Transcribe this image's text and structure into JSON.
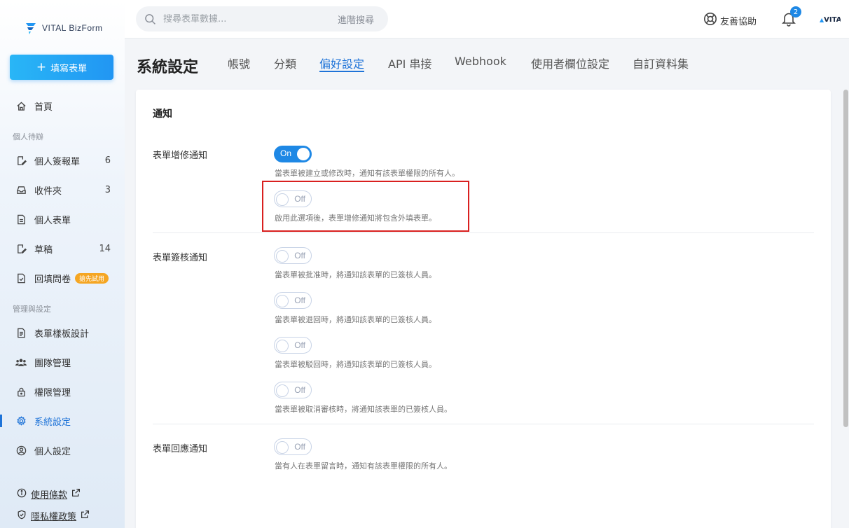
{
  "app": {
    "logo_text": "VITAL BizForm"
  },
  "sidebar": {
    "fill_form_label": "填寫表單",
    "home": "首頁",
    "personal_section": "個人待辦",
    "items_personal": [
      {
        "label": "個人簽報單",
        "count": "6"
      },
      {
        "label": "收件夾",
        "count": "3"
      },
      {
        "label": "個人表單",
        "count": ""
      },
      {
        "label": "草稿",
        "count": "14"
      },
      {
        "label": "回填問卷",
        "badge": "搶先試用"
      }
    ],
    "admin_section": "管理與設定",
    "items_admin": [
      {
        "label": "表單樣板設計"
      },
      {
        "label": "團隊管理"
      },
      {
        "label": "權限管理"
      },
      {
        "label": "系統設定"
      },
      {
        "label": "個人設定"
      }
    ],
    "footer": {
      "terms": "使用條款",
      "privacy": "隱私權政策"
    }
  },
  "header": {
    "search_placeholder": "搜尋表單數據...",
    "advanced_search": "進階搜尋",
    "help_label": "友善協助",
    "notification_count": "2",
    "avatar_text": "VITAL"
  },
  "page": {
    "title": "系統設定",
    "tabs": [
      "帳號",
      "分類",
      "偏好設定",
      "API 串接",
      "Webhook",
      "使用者欄位設定",
      "自訂資料集"
    ],
    "active_tab": "偏好設定"
  },
  "notifications": {
    "section_title": "通知",
    "form_change": {
      "label": "表單增修通知",
      "toggle_main": {
        "state": "On",
        "desc": "當表單被建立或修改時，通知有該表單權限的所有人。"
      },
      "toggle_external": {
        "state": "Off",
        "desc": "啟用此選項後，表單增修通知將包含外填表單。"
      }
    },
    "form_approval": {
      "label": "表單簽核通知",
      "toggles": [
        {
          "state": "Off",
          "desc": "當表單被批准時，將通知該表單的已簽核人員。"
        },
        {
          "state": "Off",
          "desc": "當表單被退回時，將通知該表單的已簽核人員。"
        },
        {
          "state": "Off",
          "desc": "當表單被駁回時，將通知該表單的已簽核人員。"
        },
        {
          "state": "Off",
          "desc": "當表單被取消審核時，將通知該表單的已簽核人員。"
        }
      ]
    },
    "form_reply": {
      "label": "表單回應通知",
      "toggle": {
        "state": "Off",
        "desc": "當有人在表單留言時，通知有該表單權限的所有人。"
      }
    }
  },
  "colors": {
    "accent": "#1e73d8",
    "toggle_on": "#1e88e5",
    "highlight": "#d9201f"
  }
}
